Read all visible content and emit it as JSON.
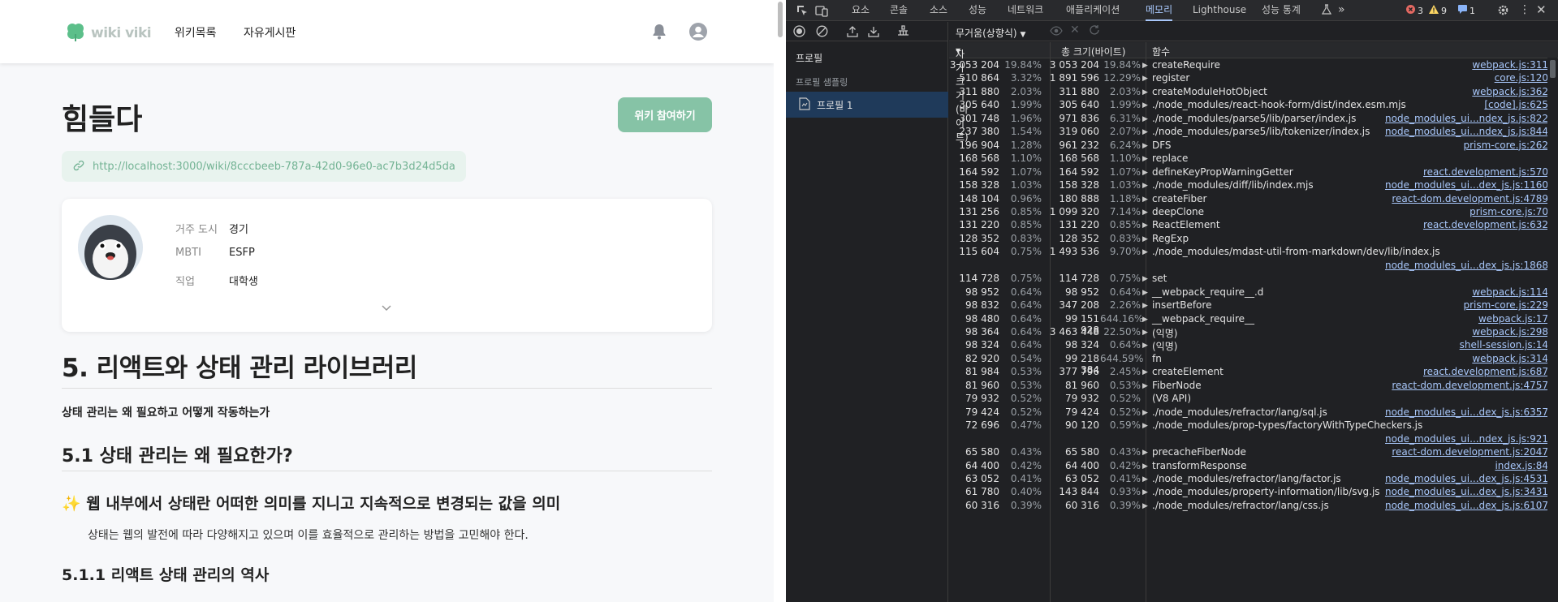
{
  "wiki": {
    "logo_text": "wiki viki",
    "nav": [
      "위키목록",
      "자유게시판"
    ],
    "title": "힘들다",
    "join_button": "위키 참여하기",
    "url": "http://localhost:3000/wiki/8cccbeeb-787a-42d0-96e0-ac7b3d24d5da",
    "profile": {
      "rows": [
        {
          "label": "거주 도시",
          "value": "경기"
        },
        {
          "label": "MBTI",
          "value": "ESFP"
        },
        {
          "label": "직업",
          "value": "대학생"
        }
      ]
    },
    "content": {
      "h1": "5. 리액트와 상태 관리 라이브러리",
      "p1": "상태 관리는 왜 필요하고 어떻게 작동하는가",
      "h2": "5.1 상태 관리는 왜 필요한가?",
      "h3": "✨ 웹 내부에서 상태란 어떠한 의미를 지니고 지속적으로 변경되는 값을 의미",
      "p2": "상태는 웹의 발전에 따라 다양해지고 있으며 이를 효율적으로 관리하는 방법을 고민해야 한다.",
      "h4": "5.1.1 리액트 상태 관리의 역사"
    },
    "colors": {
      "accent": "#86c3a6",
      "url_bg": "#e8f3ee",
      "url_text": "#73b394"
    }
  },
  "devtools": {
    "tabs": [
      "요소",
      "콘솔",
      "소스",
      "성능",
      "네트워크",
      "애플리케이션",
      "메모리",
      "Lighthouse",
      "성능 통계"
    ],
    "active_tab": "메모리",
    "issues": {
      "errors": "3",
      "warnings": "9",
      "info": "1"
    },
    "sidebar": {
      "title": "프로필",
      "subtitle": "프로필 샘플링",
      "item": "프로필 1"
    },
    "view_select": "무거움(상향식)",
    "columns": {
      "self": "자가 크기(바이트)",
      "total": "총 크기(바이트)",
      "function": "함수"
    },
    "rows": [
      {
        "self": "3 053 204",
        "selfp": "19.84%",
        "total": "3 053 204",
        "totalp": "19.84%",
        "fn": "createRequire",
        "src": "webpack.js:311",
        "tri": "▶"
      },
      {
        "self": "510 864",
        "selfp": "3.32%",
        "total": "1 891 596",
        "totalp": "12.29%",
        "fn": "register",
        "src": "core.js:120",
        "tri": "▶"
      },
      {
        "self": "311 880",
        "selfp": "2.03%",
        "total": "311 880",
        "totalp": "2.03%",
        "fn": "createModuleHotObject",
        "src": "webpack.js:362",
        "tri": "▶"
      },
      {
        "self": "305 640",
        "selfp": "1.99%",
        "total": "305 640",
        "totalp": "1.99%",
        "fn": "./node_modules/react-hook-form/dist/index.esm.mjs",
        "src": "[code].js:625",
        "tri": "▶"
      },
      {
        "self": "301 748",
        "selfp": "1.96%",
        "total": "971 836",
        "totalp": "6.31%",
        "fn": "./node_modules/parse5/lib/parser/index.js",
        "src": "node_modules_ui...ndex_js.js:822",
        "tri": "▶"
      },
      {
        "self": "237 380",
        "selfp": "1.54%",
        "total": "319 060",
        "totalp": "2.07%",
        "fn": "./node_modules/parse5/lib/tokenizer/index.js",
        "src": "node_modules_ui...ndex_js.js:844",
        "tri": "▶"
      },
      {
        "self": "196 904",
        "selfp": "1.28%",
        "total": "961 232",
        "totalp": "6.24%",
        "fn": "DFS",
        "src": "prism-core.js:262",
        "tri": "▶"
      },
      {
        "self": "168 568",
        "selfp": "1.10%",
        "total": "168 568",
        "totalp": "1.10%",
        "fn": "replace",
        "src": "",
        "tri": "▶"
      },
      {
        "self": "164 592",
        "selfp": "1.07%",
        "total": "164 592",
        "totalp": "1.07%",
        "fn": "defineKeyPropWarningGetter",
        "src": "react.development.js:570",
        "tri": "▶"
      },
      {
        "self": "158 328",
        "selfp": "1.03%",
        "total": "158 328",
        "totalp": "1.03%",
        "fn": "./node_modules/diff/lib/index.mjs",
        "src": "node_modules_ui...dex_js.js:1160",
        "tri": "▶"
      },
      {
        "self": "148 104",
        "selfp": "0.96%",
        "total": "180 888",
        "totalp": "1.18%",
        "fn": "createFiber",
        "src": "react-dom.development.js:4789",
        "tri": "▶"
      },
      {
        "self": "131 256",
        "selfp": "0.85%",
        "total": "1 099 320",
        "totalp": "7.14%",
        "fn": "deepClone",
        "src": "prism-core.js:70",
        "tri": "▶"
      },
      {
        "self": "131 220",
        "selfp": "0.85%",
        "total": "131 220",
        "totalp": "0.85%",
        "fn": "ReactElement",
        "src": "react.development.js:632",
        "tri": "▶"
      },
      {
        "self": "128 352",
        "selfp": "0.83%",
        "total": "128 352",
        "totalp": "0.83%",
        "fn": "RegExp",
        "src": "",
        "tri": "▶"
      },
      {
        "self": "115 604",
        "selfp": "0.75%",
        "total": "1 493 536",
        "totalp": "9.70%",
        "fn": "./node_modules/mdast-util-from-markdown/dev/lib/index.js",
        "src": "",
        "tri": "▶"
      },
      {
        "self": "",
        "selfp": "",
        "total": "",
        "totalp": "",
        "fn": "",
        "src": "node_modules_ui...dex_js.js:1868",
        "tri": ""
      },
      {
        "self": "114 728",
        "selfp": "0.75%",
        "total": "114 728",
        "totalp": "0.75%",
        "fn": "set",
        "src": "",
        "tri": "▶"
      },
      {
        "self": "98 952",
        "selfp": "0.64%",
        "total": "98 952",
        "totalp": "0.64%",
        "fn": "__webpack_require__.d",
        "src": "webpack.js:114",
        "tri": "▶"
      },
      {
        "self": "98 832",
        "selfp": "0.64%",
        "total": "347 208",
        "totalp": "2.26%",
        "fn": "insertBefore",
        "src": "prism-core.js:229",
        "tri": "▶"
      },
      {
        "self": "98 480",
        "selfp": "0.64%",
        "total": "99 151 928",
        "totalp": "644.16%",
        "fn": "__webpack_require__",
        "src": "webpack.js:17",
        "tri": "▶"
      },
      {
        "self": "98 364",
        "selfp": "0.64%",
        "total": "3 463 448",
        "totalp": "22.50%",
        "fn": "(익명)",
        "src": "webpack.js:298",
        "tri": "▶"
      },
      {
        "self": "98 324",
        "selfp": "0.64%",
        "total": "98 324",
        "totalp": "0.64%",
        "fn": "(익명)",
        "src": "shell-session.js:14",
        "tri": "▶"
      },
      {
        "self": "82 920",
        "selfp": "0.54%",
        "total": "99 218 384",
        "totalp": "644.59%",
        "fn": "fn",
        "src": "webpack.js:314",
        "tri": ""
      },
      {
        "self": "81 984",
        "selfp": "0.53%",
        "total": "377 796",
        "totalp": "2.45%",
        "fn": "createElement",
        "src": "react.development.js:687",
        "tri": "▶"
      },
      {
        "self": "81 960",
        "selfp": "0.53%",
        "total": "81 960",
        "totalp": "0.53%",
        "fn": "FiberNode",
        "src": "react-dom.development.js:4757",
        "tri": "▶"
      },
      {
        "self": "79 932",
        "selfp": "0.52%",
        "total": "79 932",
        "totalp": "0.52%",
        "fn": "(V8 API)",
        "src": "",
        "tri": ""
      },
      {
        "self": "79 424",
        "selfp": "0.52%",
        "total": "79 424",
        "totalp": "0.52%",
        "fn": "./node_modules/refractor/lang/sql.js",
        "src": "node_modules_ui...dex_js.js:6357",
        "tri": "▶"
      },
      {
        "self": "72 696",
        "selfp": "0.47%",
        "total": "90 120",
        "totalp": "0.59%",
        "fn": "./node_modules/prop-types/factoryWithTypeCheckers.js",
        "src": "",
        "tri": "▶"
      },
      {
        "self": "",
        "selfp": "",
        "total": "",
        "totalp": "",
        "fn": "",
        "src": "node_modules_ui...ndex_js.js:921",
        "tri": ""
      },
      {
        "self": "65 580",
        "selfp": "0.43%",
        "total": "65 580",
        "totalp": "0.43%",
        "fn": "precacheFiberNode",
        "src": "react-dom.development.js:2047",
        "tri": "▶"
      },
      {
        "self": "64 400",
        "selfp": "0.42%",
        "total": "64 400",
        "totalp": "0.42%",
        "fn": "transformResponse",
        "src": "index.js:84",
        "tri": "▶"
      },
      {
        "self": "63 052",
        "selfp": "0.41%",
        "total": "63 052",
        "totalp": "0.41%",
        "fn": "./node_modules/refractor/lang/factor.js",
        "src": "node_modules_ui...dex_js.js:4531",
        "tri": "▶"
      },
      {
        "self": "61 780",
        "selfp": "0.40%",
        "total": "143 844",
        "totalp": "0.93%",
        "fn": "./node_modules/property-information/lib/svg.js",
        "src": "node_modules_ui...dex_js.js:3431",
        "tri": "▶"
      },
      {
        "self": "60 316",
        "selfp": "0.39%",
        "total": "60 316",
        "totalp": "0.39%",
        "fn": "./node_modules/refractor/lang/css.js",
        "src": "node_modules_ui...dex_js.js:6107",
        "tri": "▶"
      }
    ]
  }
}
